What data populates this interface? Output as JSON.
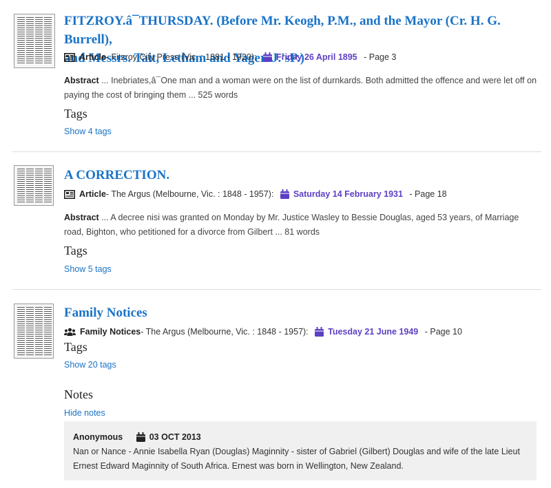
{
  "results": [
    {
      "title_line1": "FITZROY.â¯THURSDAY. (Before Mr. Keogh, P.M., and the Mayor (Cr. H. G. Burrell),",
      "title_line2": "and Messrs. Tait, Letham and Yager. J.'sP.)",
      "type": "Article",
      "source": "- Fitzroy City Press (Vic. : 1881 - 1920):",
      "date": "Friday 26 April 1895",
      "page": "- Page 3",
      "abstract_label": "Abstract",
      "abstract_text": "... Inebriates,â¯One man and a woman were on the list of durnkards. Both admitted the offence and were let off on paying the cost of bringing them ... 525 words",
      "tags_heading": "Tags",
      "tags_link": "Show 4 tags"
    },
    {
      "title_line1": "A CORRECTION.",
      "type": "Article",
      "source": "- The Argus (Melbourne, Vic. : 1848 - 1957):",
      "date": "Saturday 14 February 1931",
      "page": "- Page 18",
      "abstract_label": "Abstract",
      "abstract_text": "... A decree nisi was granted on Monday by Mr. Justice Wasley to Bessie Douglas, aged 53 years, of Marriage road, Bighton, who petitioned for a divorce from Gilbert ... 81 words",
      "tags_heading": "Tags",
      "tags_link": "Show 5 tags"
    },
    {
      "title_line1": "Family Notices",
      "type": "Family Notices",
      "source": "- The Argus (Melbourne, Vic. : 1848 - 1957):",
      "date": "Tuesday 21 June 1949",
      "page": "- Page 10",
      "tags_heading": "Tags",
      "tags_link": "Show 20 tags",
      "notes_heading": "Notes",
      "notes_link": "Hide notes",
      "note": {
        "author": "Anonymous",
        "date": "03 OCT 2013",
        "text": "Nan or Nance - Annie Isabella Ryan (Douglas) Maginnity - sister of Gabriel (Gilbert) Douglas and wife of the late Lieut Ernest Edward Maginnity of South Africa. Ernest was born in Wellington, New Zealand."
      }
    }
  ],
  "colors": {
    "link": "#1a73c7",
    "date": "#5d3fc4",
    "note_bg": "#f0f0f0"
  },
  "icons": {
    "article": "newspaper-icon",
    "calendar": "calendar-icon",
    "family": "users-icon"
  }
}
